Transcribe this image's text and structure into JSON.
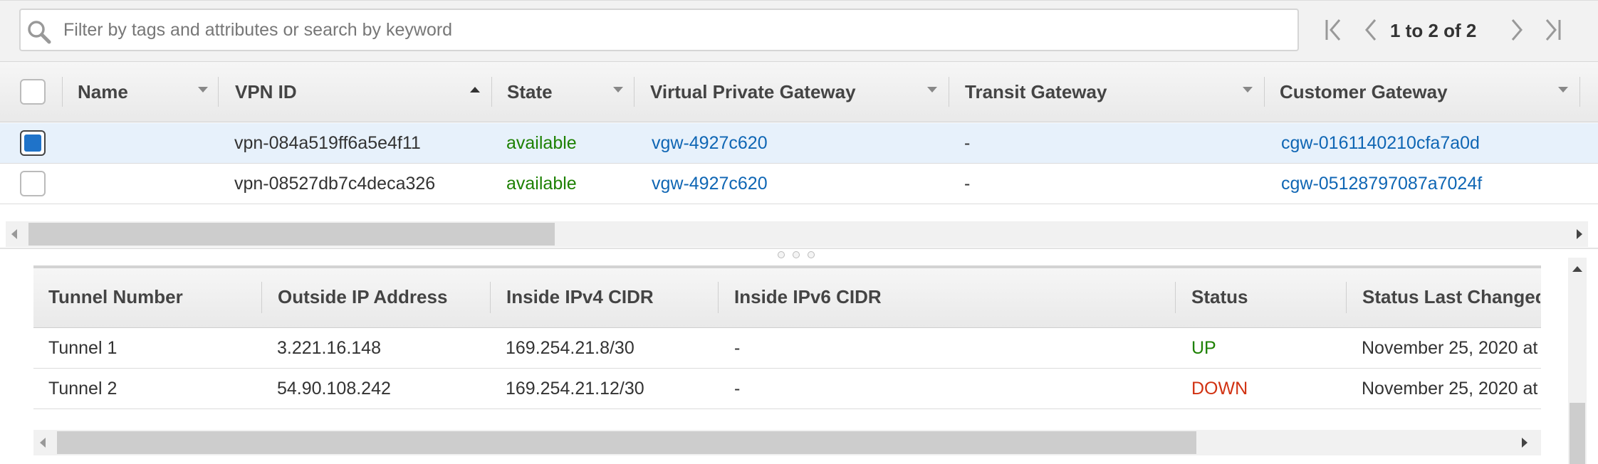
{
  "search": {
    "placeholder": "Filter by tags and attributes or search by keyword",
    "value": ""
  },
  "pagination": {
    "label": "1 to 2 of 2",
    "first_icon": "first-page-icon",
    "prev_icon": "previous-page-icon",
    "next_icon": "next-page-icon",
    "last_icon": "last-page-icon"
  },
  "vpn_table": {
    "columns": [
      {
        "label": "Name",
        "sort": "none"
      },
      {
        "label": "VPN ID",
        "sort": "ascending"
      },
      {
        "label": "State",
        "sort": "none"
      },
      {
        "label": "Virtual Private Gateway",
        "sort": "none"
      },
      {
        "label": "Transit Gateway",
        "sort": "none"
      },
      {
        "label": "Customer Gateway",
        "sort": "none"
      }
    ],
    "rows": [
      {
        "selected": true,
        "name": "",
        "vpn_id": "vpn-084a519ff6a5e4f11",
        "state": "available",
        "virtual_private_gateway": "vgw-4927c620",
        "transit_gateway": "-",
        "customer_gateway": "cgw-0161140210cfa7a0d"
      },
      {
        "selected": false,
        "name": "",
        "vpn_id": "vpn-08527db7c4deca326",
        "state": "available",
        "virtual_private_gateway": "vgw-4927c620",
        "transit_gateway": "-",
        "customer_gateway": "cgw-05128797087a7024f"
      }
    ]
  },
  "tunnel_table": {
    "columns": [
      {
        "label": "Tunnel Number"
      },
      {
        "label": "Outside IP Address"
      },
      {
        "label": "Inside IPv4 CIDR"
      },
      {
        "label": "Inside IPv6 CIDR"
      },
      {
        "label": "Status"
      },
      {
        "label": "Status Last Changed"
      }
    ],
    "rows": [
      {
        "tunnel": "Tunnel 1",
        "outside_ip": "3.221.16.148",
        "inside_ipv4": "169.254.21.8/30",
        "inside_ipv6": "-",
        "status": "UP",
        "last_changed": "November 25, 2020 at"
      },
      {
        "tunnel": "Tunnel 2",
        "outside_ip": "54.90.108.242",
        "inside_ipv4": "169.254.21.12/30",
        "inside_ipv6": "-",
        "status": "DOWN",
        "last_changed": "November 25, 2020 at"
      }
    ]
  },
  "colors": {
    "available": "#1d8102",
    "link": "#0f66b4",
    "status_up": "#1d8102",
    "status_down": "#d13212",
    "checkbox_selected": "#1f73c9",
    "selected_row": "#e7f1fb"
  },
  "scroll": {
    "upper_horizontal_thumb_fraction": 0.34,
    "lower_horizontal_thumb_fraction": 0.78
  }
}
